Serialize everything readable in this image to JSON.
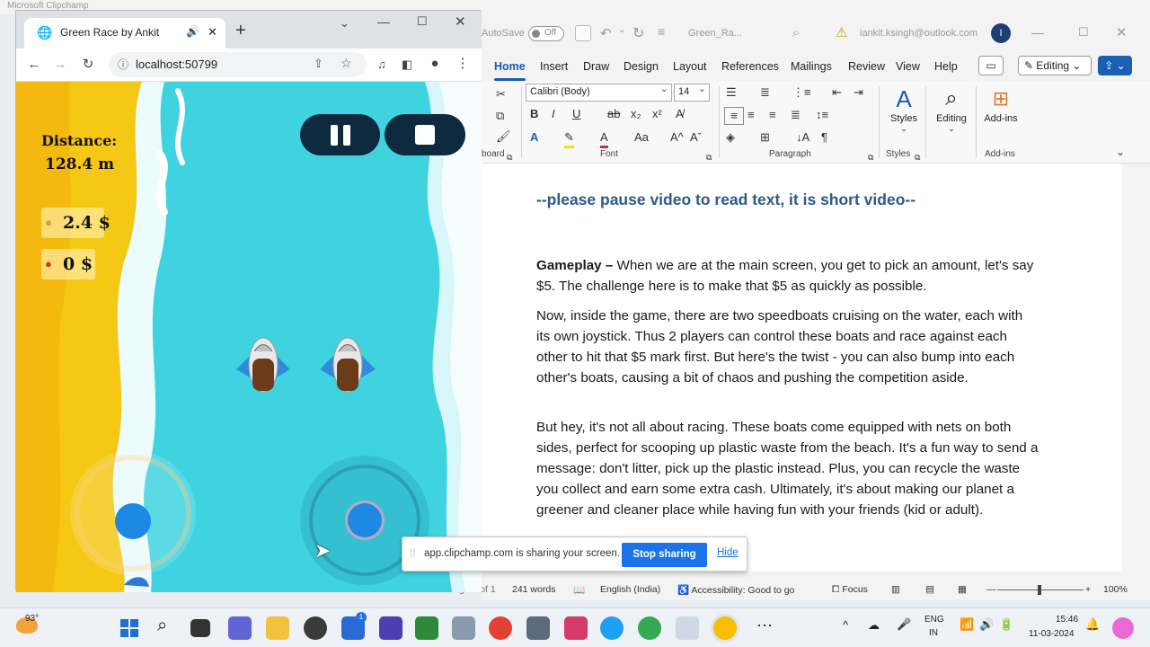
{
  "background_window": {
    "title": "Microsoft Clipchamp"
  },
  "browser": {
    "tab_title": "Green Race by Ankit",
    "url": "localhost:50799",
    "new_tab_symbol": "+"
  },
  "game": {
    "distance_label": "Distance:",
    "distance_value": "128.4 m",
    "player1_money": "2.4 $",
    "player2_money": "0 $",
    "pause_icon": "pause-icon",
    "stop_icon": "stop-icon",
    "colors": {
      "sand": "#f5c816",
      "water": "#3fd3e0",
      "button": "#0e2a3e",
      "joystick": "#1e88e5"
    }
  },
  "word": {
    "autosave_label": "AutoSave",
    "autosave_state": "Off",
    "doc_title": "Green_Ra...",
    "account": "iankit.ksingh@outlook.com",
    "avatar_initial": "I",
    "tabs": [
      "Home",
      "Insert",
      "Draw",
      "Design",
      "Layout",
      "References",
      "Mailings",
      "Review",
      "View",
      "Help"
    ],
    "editing_button": "Editing",
    "font_name": "Calibri (Body)",
    "font_size": "14",
    "groups": {
      "clipboard": "board",
      "font": "Font",
      "paragraph": "Paragraph",
      "styles": "Styles",
      "addins": "Add-ins"
    },
    "big_buttons": {
      "styles": "Styles",
      "editing": "Editing",
      "addins": "Add-ins"
    },
    "document": {
      "heading": "--please pause video to read text, it is short video--",
      "para1_bold": "Gameplay –",
      "para1": " When we are at the main screen, you get to pick an amount, let's say $5. The challenge here is to make that $5 as quickly as possible.",
      "para2": "Now, inside the game, there are two speedboats cruising on the water, each with its own joystick. Thus 2 players can control these boats and race against each other to hit that $5 mark first. But here's the twist - you can also bump into each other's boats, causing a bit of chaos and pushing the competition aside.",
      "para3": "But hey, it's not all about racing. These boats come equipped with nets on both sides, perfect for scooping up plastic waste from the beach. It's a fun way to send a message: don't litter, pick up the plastic instead. Plus, you can recycle the waste you collect and earn some extra cash. Ultimately, it's about making our planet a greener and cleaner place while having fun with your friends (kid or adult)."
    },
    "status": {
      "page": "Page 1 of 1",
      "words": "241 words",
      "language": "English (India)",
      "accessibility": "Accessibility: Good to go",
      "focus": "Focus",
      "zoom": "100%"
    }
  },
  "share_banner": {
    "message": "app.clipchamp.com is sharing your screen.",
    "stop_label": "Stop sharing",
    "hide_label": "Hide"
  },
  "taskbar": {
    "weather_temp": "93°",
    "store_badge": "1",
    "language": "ENG",
    "region": "IN",
    "time": "15:46",
    "date": "11-03-2024"
  }
}
